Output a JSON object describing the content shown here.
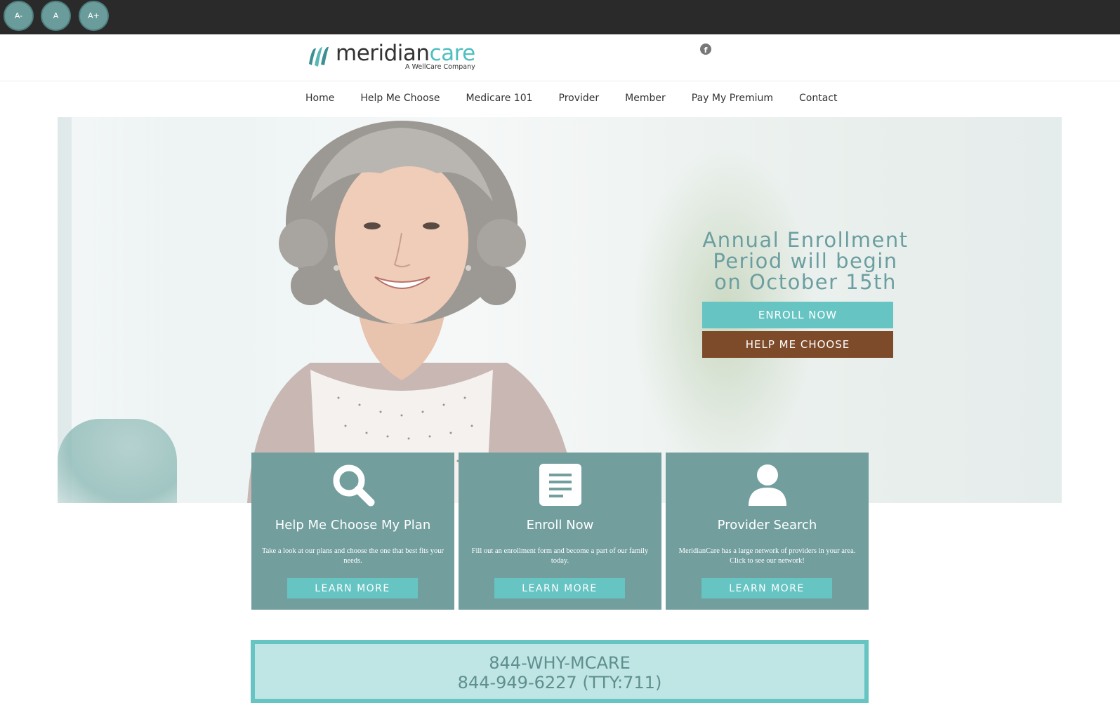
{
  "font_buttons": [
    "A-",
    "A",
    "A+"
  ],
  "logo": {
    "word_main": "meridian",
    "word_accent": "care",
    "subtitle": "A WellCare Company",
    "icon": "meridiancare-logo-icon"
  },
  "social": {
    "icon": "facebook-icon",
    "glyph": "f"
  },
  "nav": [
    "Home",
    "Help Me Choose",
    "Medicare 101",
    "Provider",
    "Member",
    "Pay My Premium",
    "Contact"
  ],
  "hero": {
    "heading_lines": [
      "Annual Enrollment",
      "Period will begin",
      "on October 15th"
    ],
    "enroll_label": "ENROLL NOW",
    "help_label": "HELP ME CHOOSE"
  },
  "cards": [
    {
      "icon": "search-icon",
      "title": "Help Me Choose My Plan",
      "desc": "Take a look at our plans and choose the one that best fits your needs.",
      "button": "LEARN MORE"
    },
    {
      "icon": "document-icon",
      "title": "Enroll Now",
      "desc": "Fill out an enrollment form and become a part of our family today.",
      "button": "LEARN MORE"
    },
    {
      "icon": "user-icon",
      "title": "Provider Search",
      "desc": "MeridianCare has a large network of providers in your area. Click to see our network!",
      "button": "LEARN MORE"
    }
  ],
  "phone": {
    "vanity": "844-WHY-MCARE",
    "number": "844-949-6227 (TTY:711)"
  },
  "colors": {
    "teal": "#66c4c3",
    "card_bg": "#729e9e",
    "brown": "#7d4a2a",
    "topbar": "#2a2a2a",
    "hero_text": "#6b9ea0"
  }
}
